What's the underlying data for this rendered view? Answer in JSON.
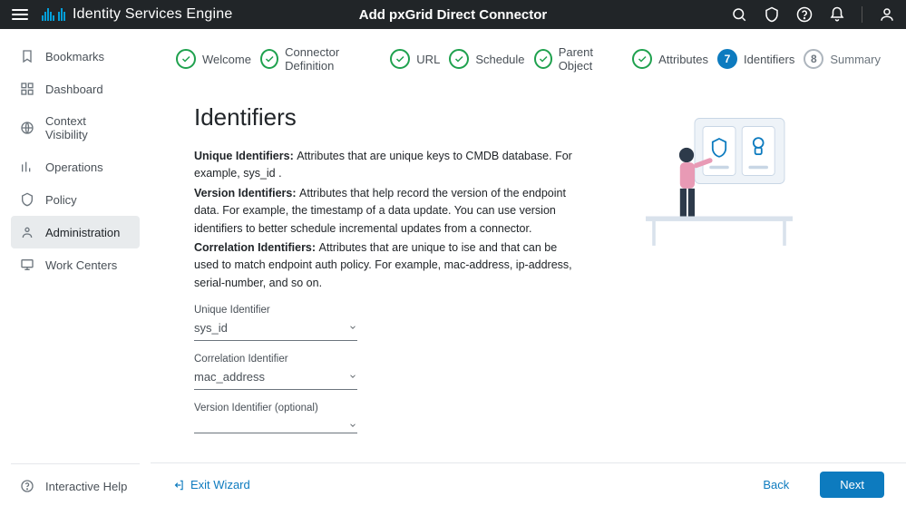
{
  "header": {
    "app_title": "Identity Services Engine",
    "page_title": "Add pxGrid Direct Connector"
  },
  "sidebar": {
    "items": [
      {
        "label": "Bookmarks",
        "icon": "bookmark-icon"
      },
      {
        "label": "Dashboard",
        "icon": "dashboard-icon"
      },
      {
        "label": "Context Visibility",
        "icon": "context-icon"
      },
      {
        "label": "Operations",
        "icon": "operations-icon"
      },
      {
        "label": "Policy",
        "icon": "policy-icon"
      },
      {
        "label": "Administration",
        "icon": "administration-icon"
      },
      {
        "label": "Work Centers",
        "icon": "workcenters-icon"
      }
    ],
    "active_index": 5,
    "help_label": "Interactive Help"
  },
  "steps": [
    {
      "label": "Welcome",
      "state": "done"
    },
    {
      "label": "Connector Definition",
      "state": "done"
    },
    {
      "label": "URL",
      "state": "done"
    },
    {
      "label": "Schedule",
      "state": "done"
    },
    {
      "label": "Parent Object",
      "state": "done"
    },
    {
      "label": "Attributes",
      "state": "done"
    },
    {
      "label": "Identifiers",
      "state": "current",
      "num": "7"
    },
    {
      "label": "Summary",
      "state": "future",
      "num": "8"
    }
  ],
  "section": {
    "title": "Identifiers",
    "unique_strong": "Unique Identifiers: ",
    "unique_text": "Attributes that are unique keys to CMDB database. For example, sys_id .",
    "version_strong": "Version Identifiers: ",
    "version_text": "Attributes that help record the version of the endpoint data. For example, the timestamp of a data update. You can use version identifiers to better schedule incremental updates from a connector.",
    "correlation_strong": "Correlation Identifiers: ",
    "correlation_text": "Attributes that are unique to ise and that can be used to match endpoint auth policy. For example, mac-address, ip-address, serial-number, and so on."
  },
  "fields": {
    "unique_label": "Unique Identifier",
    "unique_value": "sys_id",
    "correlation_label": "Correlation Identifier",
    "correlation_value": "mac_address",
    "version_label": "Version Identifier (optional)",
    "version_value": ""
  },
  "footer": {
    "exit": "Exit Wizard",
    "back": "Back",
    "next": "Next"
  }
}
